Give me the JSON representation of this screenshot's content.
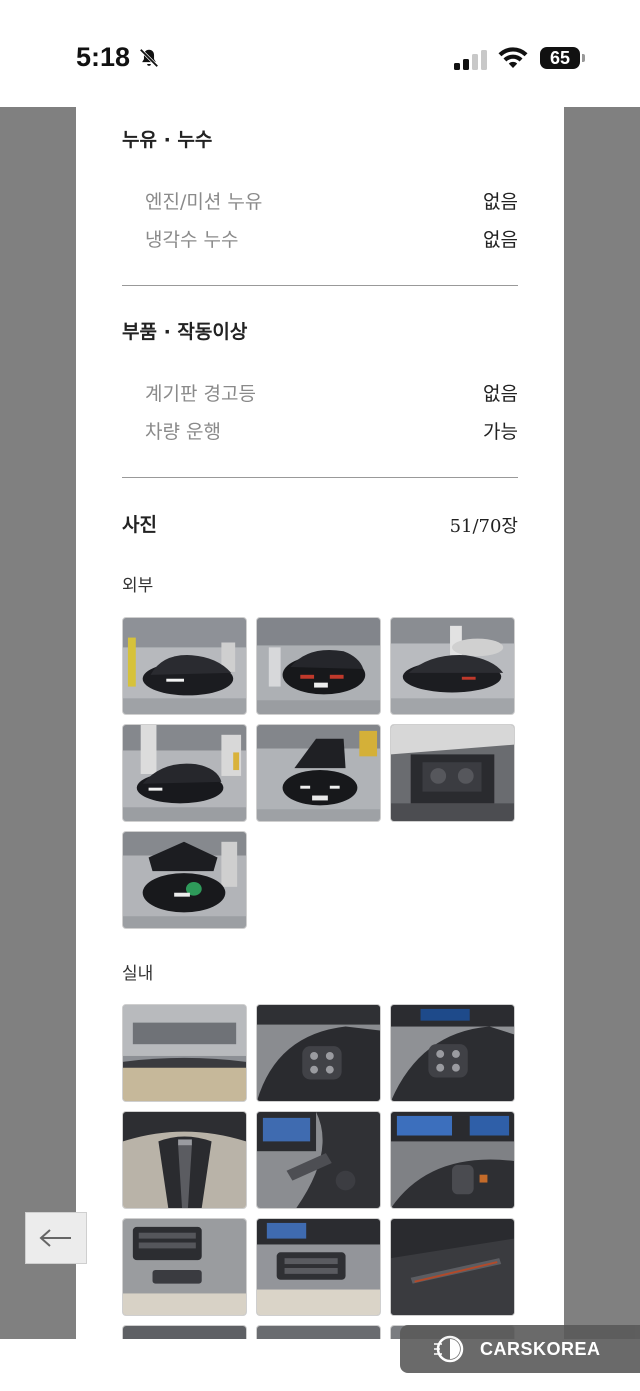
{
  "status": {
    "time": "5:18",
    "battery": "65"
  },
  "sections": {
    "leak": {
      "title": "누유 · 누수",
      "rows": [
        {
          "label": "엔진/미션 누유",
          "value": "없음"
        },
        {
          "label": "냉각수 누수",
          "value": "없음"
        }
      ]
    },
    "parts": {
      "title": "부품 · 작동이상",
      "rows": [
        {
          "label": "계기판 경고등",
          "value": "없음"
        },
        {
          "label": "차량 운행",
          "value": "가능"
        }
      ]
    },
    "photos": {
      "title": "사진",
      "count": "51/70장",
      "exterior_label": "외부",
      "interior_label": "실내"
    }
  },
  "icons": {
    "back": "arrow-left-icon",
    "muted": "bell-slash-icon",
    "brand": "carskorea-logo-icon"
  },
  "brand": {
    "name": "CARSKOREA"
  },
  "colors": {
    "gutter": "#808080",
    "divider": "#999999",
    "label_gray": "#8a8a8a"
  }
}
